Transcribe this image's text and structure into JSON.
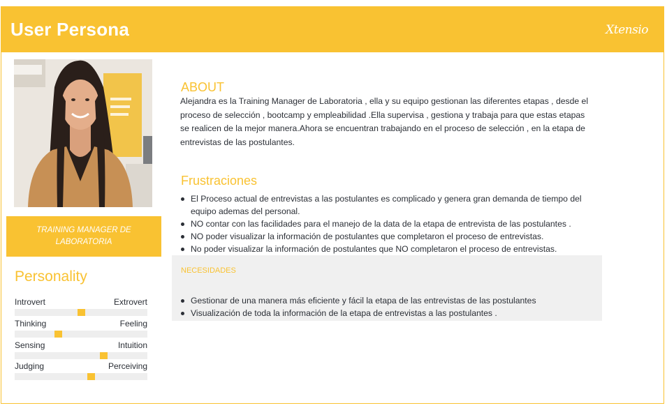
{
  "header": {
    "title": "User Persona",
    "logo": "Xtensio"
  },
  "profile": {
    "role": "TRAINING MANAGER DE LABORATORIA"
  },
  "personality": {
    "title": "Personality",
    "traits": [
      {
        "left": "Introvert",
        "right": "Extrovert",
        "level": 0.5
      },
      {
        "left": "Thinking",
        "right": "Feeling",
        "level": 0.32
      },
      {
        "left": "Sensing",
        "right": "Intuition",
        "level": 0.68
      },
      {
        "left": "Judging",
        "right": "Perceiving",
        "level": 0.58
      }
    ]
  },
  "about": {
    "title": "ABOUT",
    "text": "Alejandra es la Training Manager de Laboratoria , ella y su equipo  gestionan  las diferentes etapas    , desde el proceso de selección   , bootcamp  y empleabilidad  .Ella supervisa , gestiona y trabaja para que estas etapas se realicen  de la mejor manera.Ahora se encuentran trabajando  en el proceso de selección , en la etapa de entrevistas de las postulantes."
  },
  "frustrations": {
    "title": "Frustraciones",
    "items": [
      "El Proceso actual de entrevistas a las postulantes es complicado y genera gran demanda de tiempo del equipo ademas  del personal.",
      "NO contar con las facilidades para el manejo de la data de la etapa de entrevista de  las postulantes .",
      "NO poder visualizar  la información  de postulantes que completaron el proceso de  entrevistas.",
      "No poder visualizar la información  de postulantes que NO completaron el proceso de  entrevistas."
    ]
  },
  "needs": {
    "title": "NECESIDADES",
    "items": [
      "Gestionar de  una manera más eficiente y fácil  la etapa de las entrevistas    de las postulantes",
      "Visualización de toda la información  de la etapa de entrevistas a las postulantes ."
    ]
  },
  "colors": {
    "accent": "#f9c232",
    "text": "#2b2f36",
    "track": "#eeeeee",
    "panel": "#f0f0f0"
  }
}
